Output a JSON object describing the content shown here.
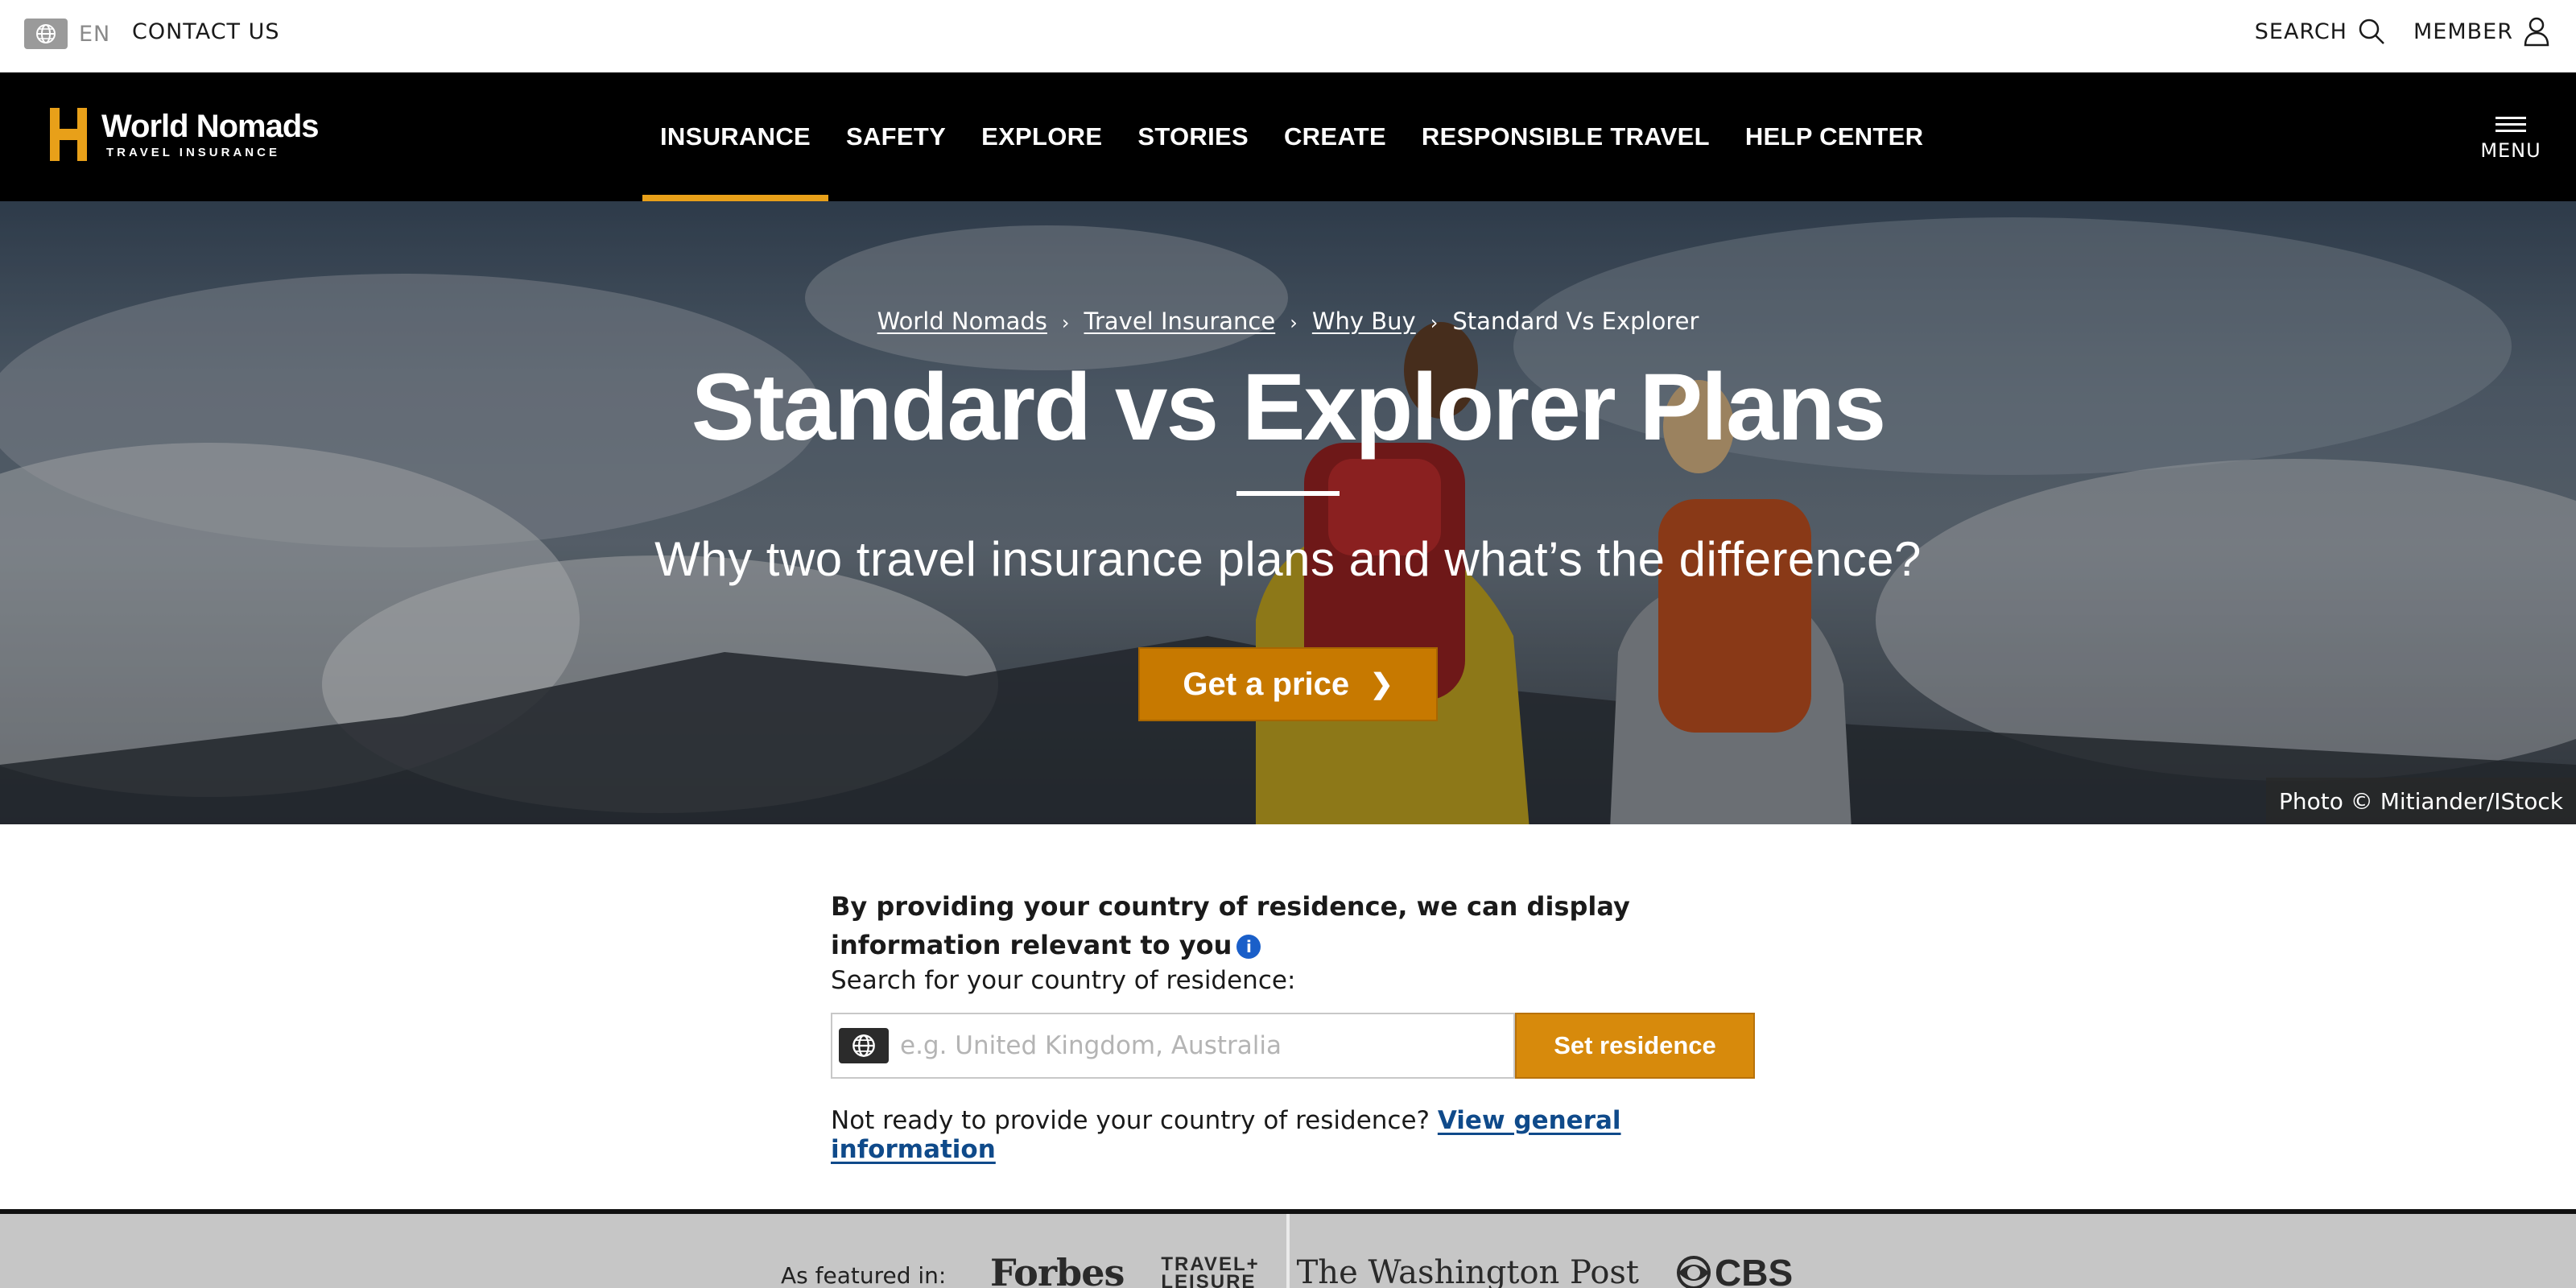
{
  "topbar": {
    "language_code": "EN",
    "contact_label": "CONTACT US",
    "search_label": "SEARCH",
    "member_label": "MEMBER"
  },
  "nav": {
    "logo_title": "World Nomads",
    "logo_subtitle": "TRAVEL INSURANCE",
    "items": [
      {
        "label": "INSURANCE",
        "active": true
      },
      {
        "label": "SAFETY",
        "active": false
      },
      {
        "label": "EXPLORE",
        "active": false
      },
      {
        "label": "STORIES",
        "active": false
      },
      {
        "label": "CREATE",
        "active": false
      },
      {
        "label": "RESPONSIBLE TRAVEL",
        "active": false
      },
      {
        "label": "HELP CENTER",
        "active": false
      }
    ],
    "menu_label": "MENU",
    "accent_color": "#e8a019"
  },
  "hero": {
    "breadcrumb": [
      "World Nomads",
      "Travel Insurance",
      "Why Buy",
      "Standard Vs Explorer"
    ],
    "title": "Standard vs Explorer Plans",
    "subtitle": "Why two travel insurance plans and what’s the difference?",
    "cta_label": "Get a price",
    "cta_color": "#c77900",
    "photo_credit": "Photo © Mitiander/IStock"
  },
  "residence": {
    "lead": "By providing your country of residence, we can display information relevant to you",
    "info_icon": "i",
    "search_label": "Search for your country of residence:",
    "placeholder": "e.g. United Kingdom, Australia",
    "button_label": "Set residence",
    "button_color": "#d78a0c",
    "note_text": "Not ready to provide your country of residence?",
    "note_link": "View general information"
  },
  "featured": {
    "label": "As featured in:",
    "logos": [
      "Forbes",
      "TRAVEL+",
      "LEISURE",
      "The Washington Post",
      "CBS"
    ]
  }
}
